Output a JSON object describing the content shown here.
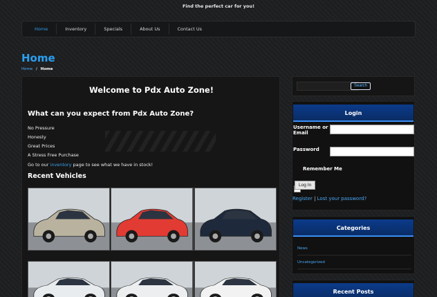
{
  "site": {
    "tagline": "Find the perfect car for you!"
  },
  "nav": {
    "items": [
      "Home",
      "Inventory",
      "Specials",
      "About Us",
      "Contact Us"
    ]
  },
  "page": {
    "title": "Home",
    "breadcrumb": {
      "link": "Home",
      "sep": "/",
      "current": "Home"
    }
  },
  "content": {
    "welcome": "Welcome to Pdx Auto Zone!",
    "expect_heading": "What can you expect from Pdx Auto Zone?",
    "points": [
      "No Pressure",
      "Honesty",
      "Great Prices",
      "A Stress Free Purchase"
    ],
    "goto_prefix": "Go to our ",
    "goto_link": "inventory",
    "goto_suffix": " page to see what we have in stock!",
    "recent_heading": "Recent Vehicles",
    "vehicles": [
      {
        "color": "#b9b29e",
        "label": "silver sedan"
      },
      {
        "color": "#e23b33",
        "label": "red hatchback"
      },
      {
        "color": "#1e2a3c",
        "label": "dark blue sedan"
      },
      {
        "color": "#e9ecef",
        "label": "white sedan"
      },
      {
        "color": "#eceef0",
        "label": "white sedan"
      },
      {
        "color": "#f2f2f2",
        "label": "white sedan"
      }
    ]
  },
  "sidebar": {
    "search": {
      "button": "Search",
      "placeholder": ""
    },
    "login": {
      "title": "Login",
      "username_label_1": "Username or",
      "username_label_2": "Email",
      "password_label": "Password",
      "remember": "Remember Me",
      "button": "Log In",
      "register": "Register",
      "sep": "|",
      "lost": "Lost your password?"
    },
    "categories": {
      "title": "Categories",
      "items": [
        "News",
        "Uncategorized"
      ]
    },
    "recent_posts": {
      "title": "Recent Posts"
    }
  },
  "colors": {
    "accent": "#2aa0f0",
    "widget_header": "#0b3b8a",
    "background": "#1d1e20"
  }
}
